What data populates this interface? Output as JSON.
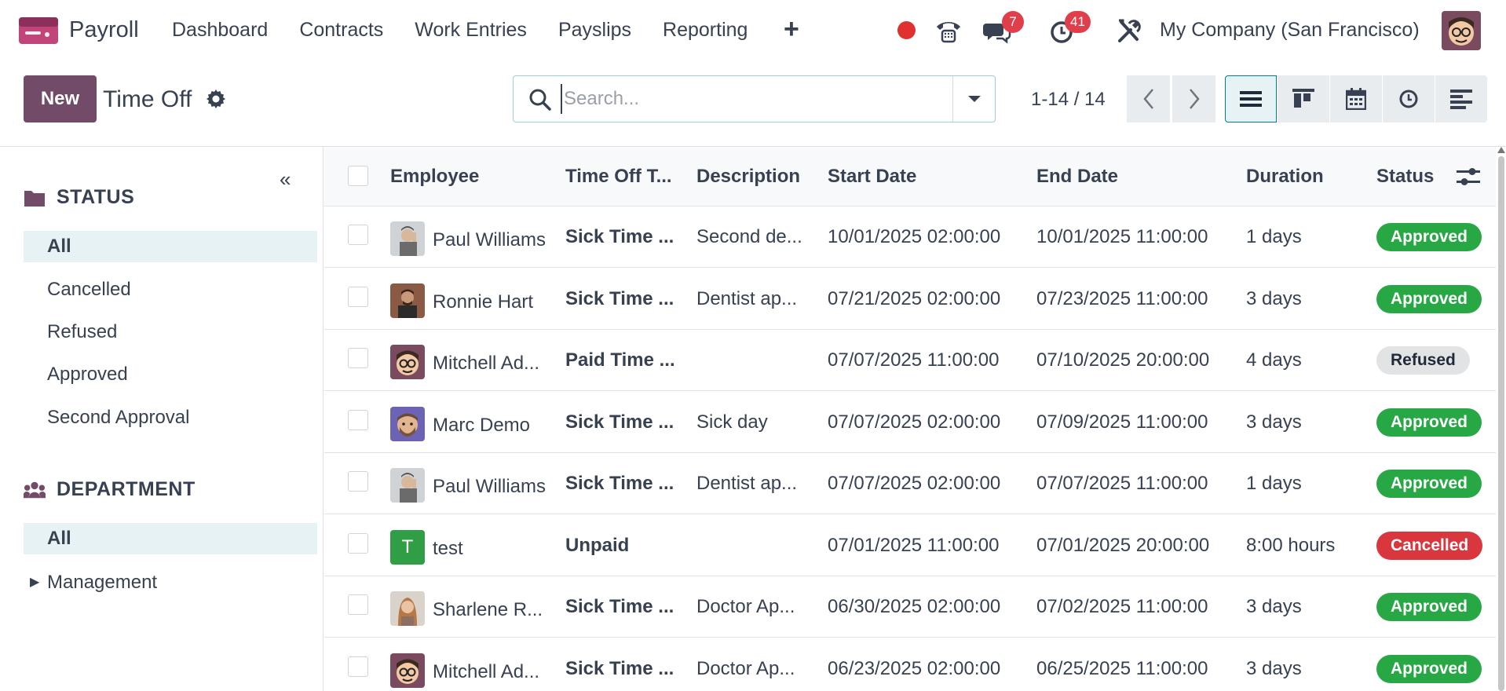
{
  "navbar": {
    "app_name": "Payroll",
    "menu": [
      "Dashboard",
      "Contracts",
      "Work Entries",
      "Payslips",
      "Reporting"
    ],
    "plus": "+",
    "messages_count": "7",
    "activities_count": "41",
    "company": "My Company (San Francisco)"
  },
  "control": {
    "new_label": "New",
    "breadcrumb": "Time Off",
    "search_placeholder": "Search...",
    "pager": "1-14 / 14"
  },
  "sidebar": {
    "collapse": "«",
    "status_title": "STATUS",
    "status_items": [
      "All",
      "Cancelled",
      "Refused",
      "Approved",
      "Second Approval"
    ],
    "department_title": "DEPARTMENT",
    "department_items": [
      "All",
      "Management"
    ]
  },
  "list": {
    "headers": [
      "Employee",
      "Time Off T...",
      "Description",
      "Start Date",
      "End Date",
      "Duration",
      "Status"
    ],
    "rows": [
      {
        "employee": "Paul Williams",
        "type": "Sick Time ...",
        "description": "Second de...",
        "start": "10/01/2025 02:00:00",
        "end": "10/01/2025 11:00:00",
        "duration": "1 days",
        "status": "Approved"
      },
      {
        "employee": "Ronnie Hart",
        "type": "Sick Time ...",
        "description": "Dentist ap...",
        "start": "07/21/2025 02:00:00",
        "end": "07/23/2025 11:00:00",
        "duration": "3 days",
        "status": "Approved"
      },
      {
        "employee": "Mitchell Ad...",
        "type": "Paid Time ...",
        "description": "",
        "start": "07/07/2025 11:00:00",
        "end": "07/10/2025 20:00:00",
        "duration": "4 days",
        "status": "Refused"
      },
      {
        "employee": "Marc Demo",
        "type": "Sick Time ...",
        "description": "Sick day",
        "start": "07/07/2025 02:00:00",
        "end": "07/09/2025 11:00:00",
        "duration": "3 days",
        "status": "Approved"
      },
      {
        "employee": "Paul Williams",
        "type": "Sick Time ...",
        "description": "Dentist ap...",
        "start": "07/07/2025 02:00:00",
        "end": "07/07/2025 11:00:00",
        "duration": "1 days",
        "status": "Approved"
      },
      {
        "employee": "test",
        "type": "Unpaid",
        "description": "",
        "start": "07/01/2025 11:00:00",
        "end": "07/01/2025 20:00:00",
        "duration": "8:00 hours",
        "status": "Cancelled",
        "initial": "T"
      },
      {
        "employee": "Sharlene R...",
        "type": "Sick Time ...",
        "description": "Doctor Ap...",
        "start": "06/30/2025 02:00:00",
        "end": "07/02/2025 11:00:00",
        "duration": "3 days",
        "status": "Approved"
      },
      {
        "employee": "Mitchell Ad...",
        "type": "Sick Time ...",
        "description": "Doctor Ap...",
        "start": "06/23/2025 02:00:00",
        "end": "06/25/2025 11:00:00",
        "duration": "3 days",
        "status": "Approved"
      }
    ]
  },
  "colors": {
    "primary": "#714b67",
    "approved": "#28a745",
    "cancelled": "#d9363e",
    "refused_bg": "#e2e3e5",
    "badge": "#e03e4b",
    "teal": "#017e84"
  }
}
